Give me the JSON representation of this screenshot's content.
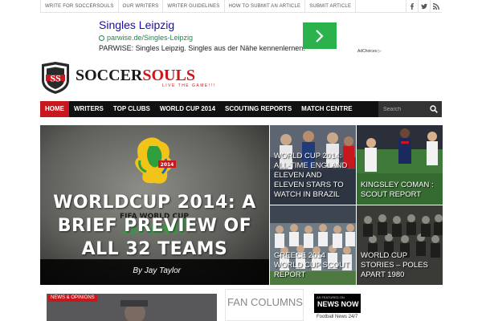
{
  "topbar": {
    "links": [
      "WRITE FOR SOCCERSOULS",
      "OUR WRITERS",
      "WRITER GUIDELINES",
      "HOW TO SUBMIT AN ARTICLE",
      "SUBMIT ARTICLE"
    ],
    "social_icons": [
      "facebook-icon",
      "twitter-icon",
      "rss-icon"
    ]
  },
  "ad": {
    "title": "Singles Leipzig",
    "url": "parwise.de/Singles-Leipzig",
    "description": "PARWISE: Singles Leipzig. Singles aus der Nähe kennenlernen.",
    "choices": "AdChoices",
    "button_color": "#2bb24c"
  },
  "logo": {
    "initials": "SS",
    "name_part1": "SOCCER",
    "name_part2": "SOULS",
    "tagline": "LIVE THE GAME!!!"
  },
  "nav": {
    "items": [
      "HOME",
      "WRITERS",
      "TOP CLUBS",
      "WORLD CUP 2014",
      "SCOUTING REPORTS",
      "MATCH CENTRE"
    ],
    "active": "HOME",
    "search_placeholder": "Search",
    "accent": "#c8181e"
  },
  "hero": {
    "title": "WORLDCUP 2014: A BRIEF PREVIEW OF ALL 32 TEAMS",
    "author": "By Jay Taylor",
    "image_text_line1": "FIFA WORLD CUP",
    "image_text_line2": "Brasil",
    "image_text_year": "2014"
  },
  "tiles": [
    {
      "title": "WORLD CUP 2014: ALL-TIME ENGLAND ELEVEN AND ELEVEN STARS TO WATCH IN BRAZIL"
    },
    {
      "title": "KINGSLEY COMAN : SCOUT REPORT"
    },
    {
      "title": "GREECE 2014 WORLD CUP SCOUT REPORT"
    },
    {
      "title": "WORLD CUP STORIES – POLES APART 1980"
    }
  ],
  "bottom": {
    "news_badge": "NEWS & OPINIONS",
    "fan_columns": "FAN COLUMNS",
    "newsnow_small": "AS FEATURED ON",
    "newsnow_big": "NEWS NOW",
    "newsnow_sub": "Football News 24/7"
  }
}
